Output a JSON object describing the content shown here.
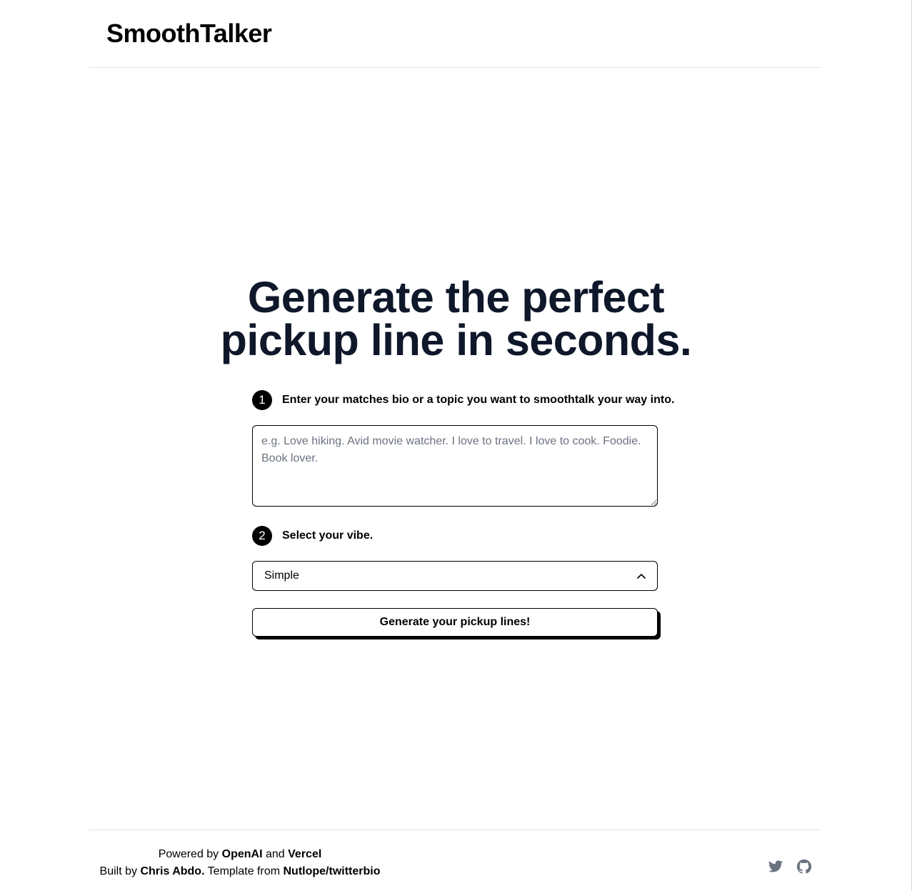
{
  "header": {
    "brand": "SmoothTalker"
  },
  "hero": {
    "title_line1": "Generate the perfect",
    "title_line2": "pickup line in seconds."
  },
  "step1": {
    "number": "1",
    "label": "Enter your matches bio or a topic you want to smoothtalk your way into.",
    "bio_placeholder": "e.g. Love hiking. Avid movie watcher. I love to travel. I love to cook. Foodie. Book lover.",
    "bio_value": ""
  },
  "step2": {
    "number": "2",
    "label": "Select your vibe.",
    "vibe_selected": "Simple"
  },
  "generate_button": {
    "label": "Generate your pickup lines!"
  },
  "footer": {
    "powered_by": "Powered by",
    "openai": "OpenAI",
    "and": "and",
    "vercel": "Vercel",
    "built_by": "Built by",
    "author": "Chris Abdo.",
    "template_from": "Template from",
    "template_repo": "Nutlope/twitterbio",
    "icons": [
      "twitter-icon",
      "github-icon"
    ],
    "icon_color": "#6b7280"
  }
}
